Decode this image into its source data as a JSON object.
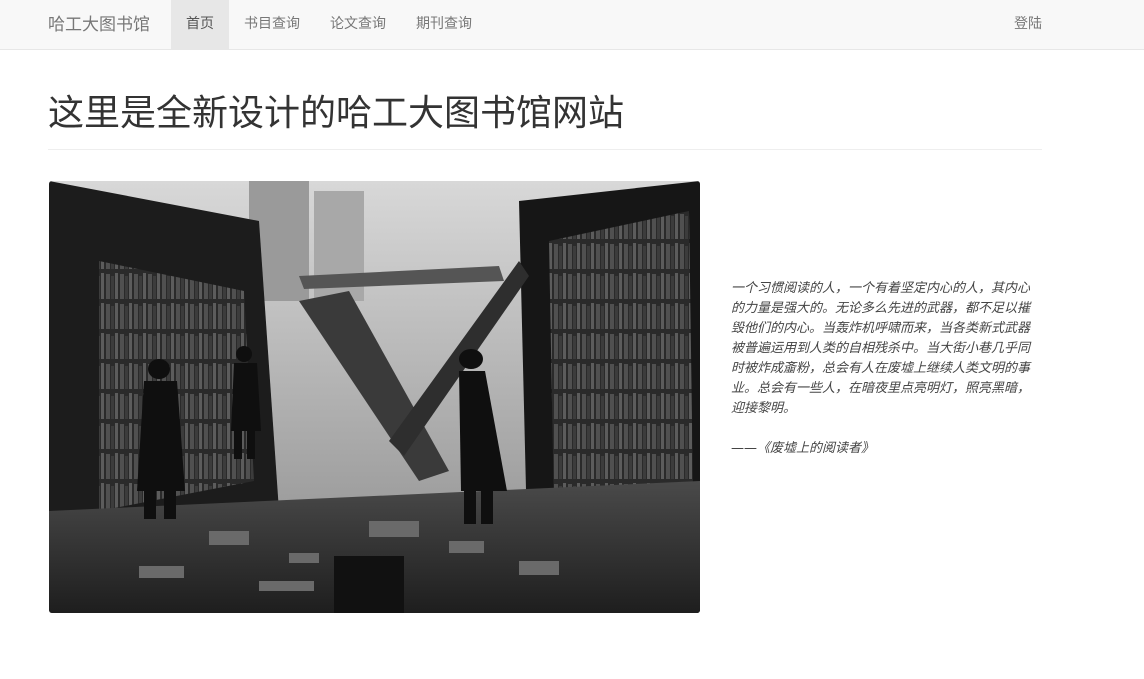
{
  "navbar": {
    "brand": "哈工大图书馆",
    "items": [
      {
        "label": "首页",
        "active": true
      },
      {
        "label": "书目查询",
        "active": false
      },
      {
        "label": "论文查询",
        "active": false
      },
      {
        "label": "期刊查询",
        "active": false
      }
    ],
    "login": "登陆"
  },
  "main": {
    "title": "这里是全新设计的哈工大图书馆网站",
    "quote": "一个习惯阅读的人，一个有着坚定内心的人，其内心的力量是强大的。无论多么先进的武器，都不足以摧毁他们的内心。当轰炸机呼啸而来，当各类新式武器被普遍运用到人类的自相残杀中。当大街小巷几乎同时被炸成齑粉，总会有人在废墟上继续人类文明的事业。总会有一些人，在暗夜里点亮明灯，照亮黑暗，迎接黎明。",
    "quote_source": "——《废墟上的阅读者》"
  },
  "colors": {
    "navbar_bg": "#f8f8f8",
    "active_tab_bg": "#e7e7e7",
    "nav_text": "#777777",
    "title_text": "#333333"
  }
}
